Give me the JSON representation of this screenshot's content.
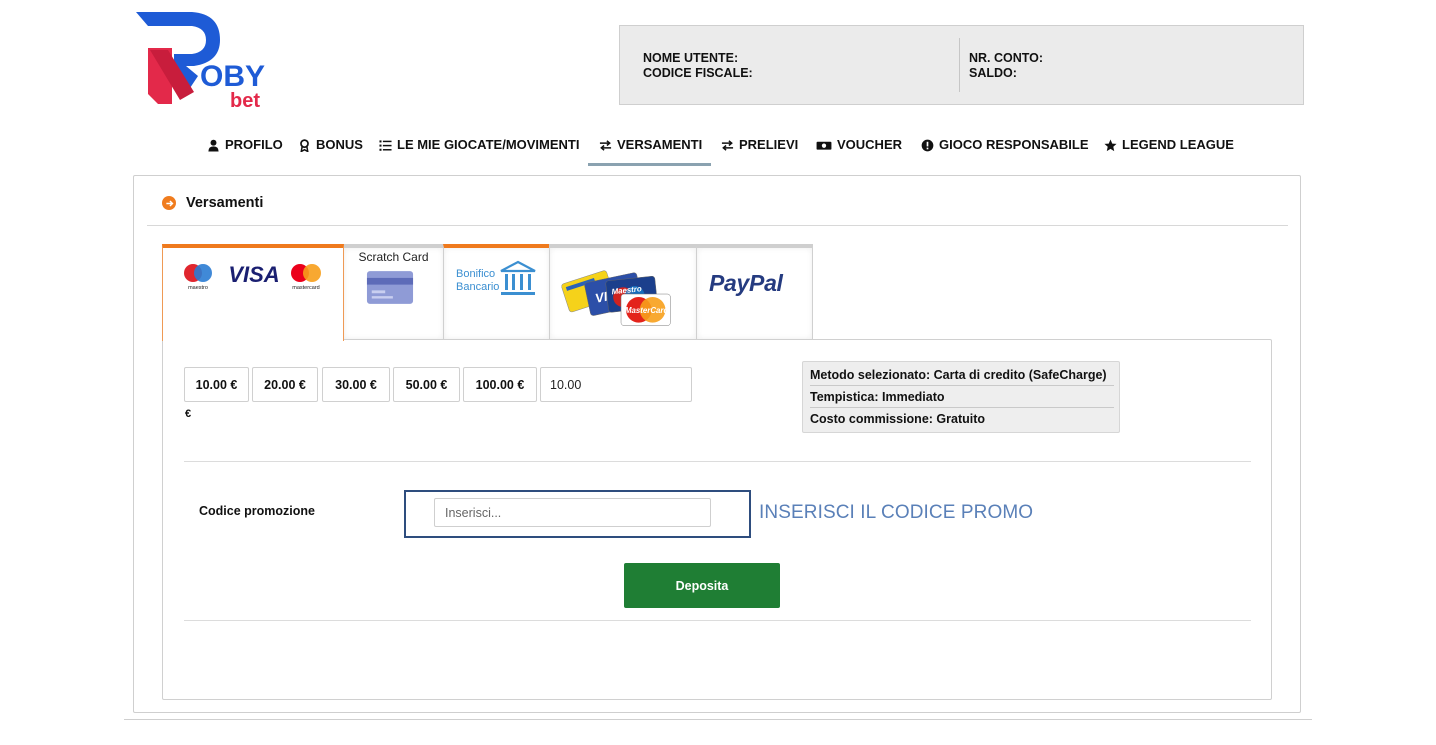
{
  "brand": {
    "logo_text_main": "OBY",
    "logo_text_sub": "bet",
    "logo_letter": "R",
    "colors": {
      "blue": "#1e5bd6",
      "red": "#e3294a"
    }
  },
  "account": {
    "username_label": "NOME UTENTE:",
    "fiscal_code_label": "CODICE FISCALE:",
    "account_no_label": "NR. CONTO:",
    "balance_label": "SALDO:"
  },
  "nav": {
    "items": [
      {
        "label": "PROFILO",
        "icon": "user-icon"
      },
      {
        "label": "BONUS",
        "icon": "award-icon"
      },
      {
        "label": "LE MIE GIOCATE/MOVIMENTI",
        "icon": "list-icon"
      },
      {
        "label": "VERSAMENTI",
        "icon": "exchange-icon",
        "active": true
      },
      {
        "label": "PRELIEVI",
        "icon": "exchange-icon"
      },
      {
        "label": "VOUCHER",
        "icon": "ticket-icon"
      },
      {
        "label": "GIOCO RESPONSABILE",
        "icon": "info-circle-icon"
      },
      {
        "label": "LEGEND LEAGUE",
        "icon": "star-icon"
      }
    ]
  },
  "panel": {
    "title": "Versamenti",
    "tabs": [
      {
        "name": "card-maestro-visa-mastercard",
        "maestro": "maestro",
        "visa": "VISA",
        "mastercard": "mastercard"
      },
      {
        "name": "scratch-card",
        "label": "Scratch Card"
      },
      {
        "name": "bonifico-bancario",
        "line1": "Bonifico",
        "line2": "Bancario"
      },
      {
        "name": "postepay-visa-maestro",
        "visa": "VI",
        "maestro": "Maestro",
        "mastercard": "MasterCard"
      },
      {
        "name": "paypal",
        "label": "PayPal"
      }
    ]
  },
  "deposit": {
    "amounts": [
      "10.00 €",
      "20.00 €",
      "30.00 €",
      "50.00 €",
      "100.00 €"
    ],
    "amount_value": "10.00",
    "currency": "€",
    "info": {
      "method": "Metodo selezionato: Carta di credito (SafeCharge)",
      "timing": "Tempistica: Immediato",
      "fee": "Costo commissione: Gratuito"
    },
    "promo_label": "Codice promozione",
    "promo_placeholder": "Inserisci...",
    "promo_hint": "INSERISCI IL CODICE PROMO",
    "submit_label": "Deposita"
  }
}
